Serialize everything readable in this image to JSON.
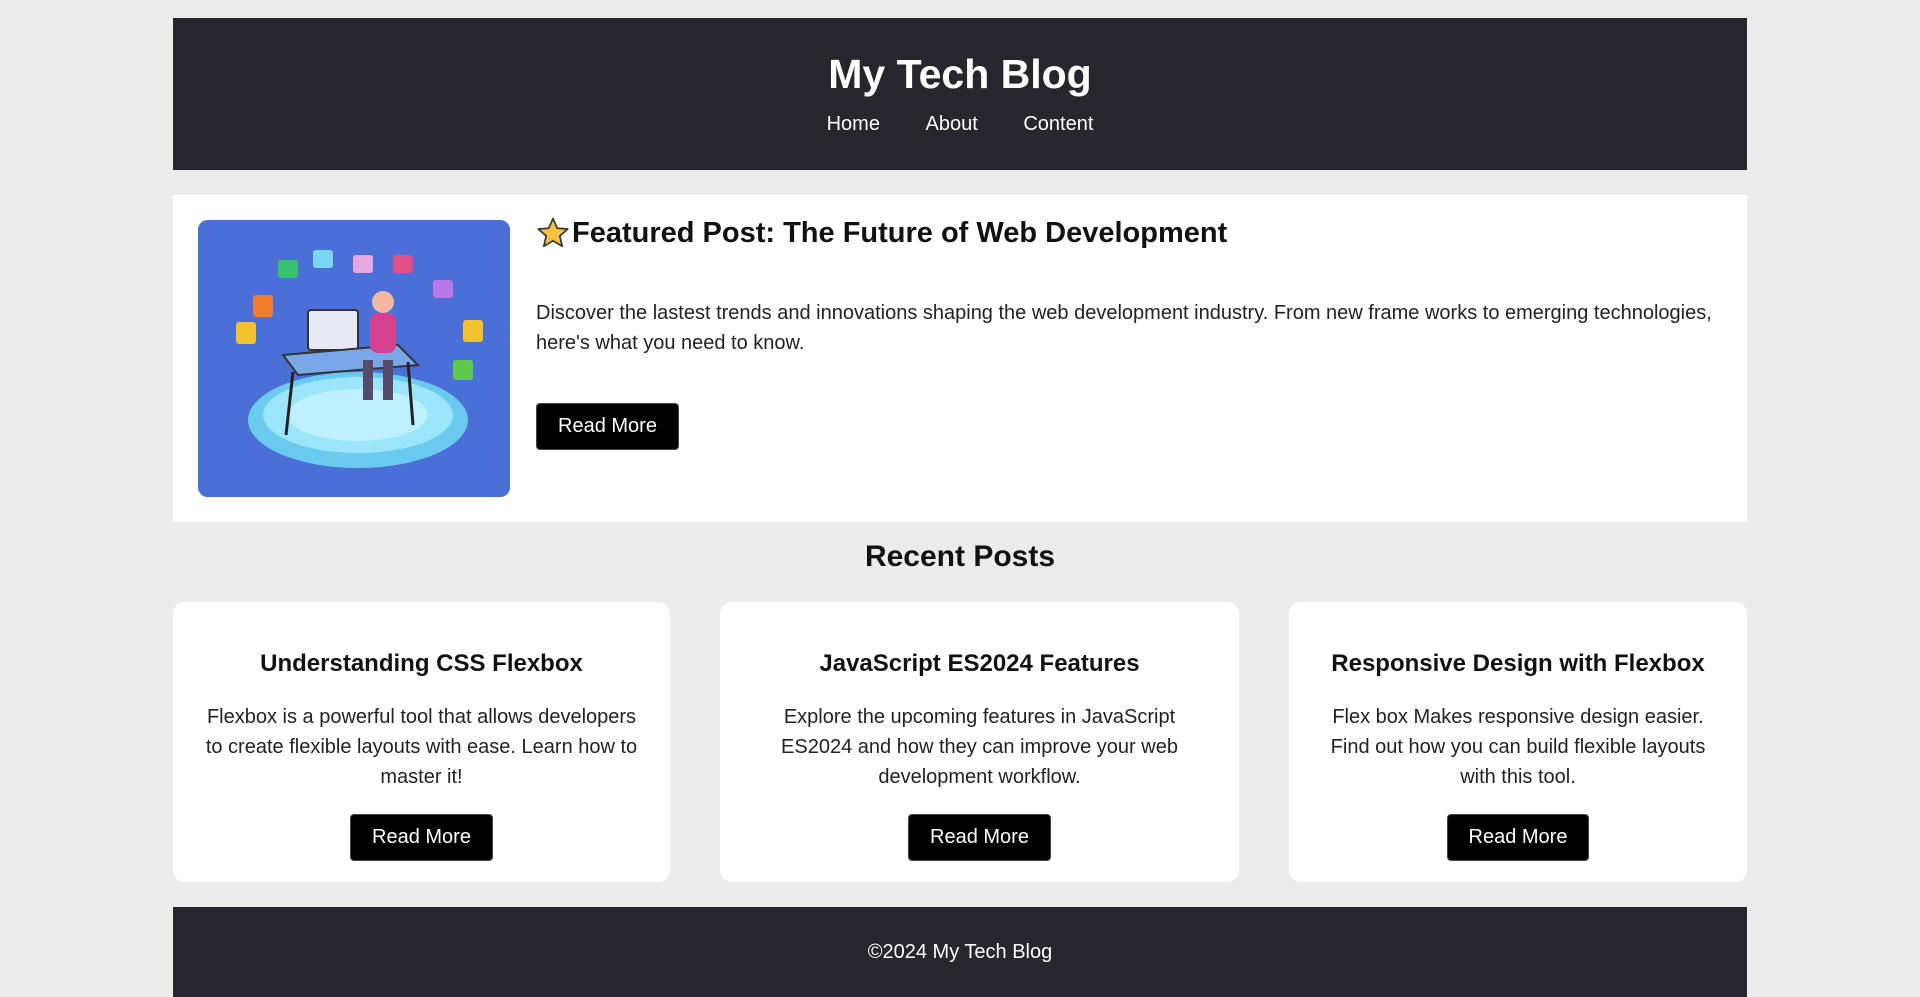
{
  "header": {
    "title": "My Tech Blog",
    "nav": [
      "Home",
      "About",
      "Content"
    ]
  },
  "featured": {
    "icon": "star-icon",
    "title": "Featured Post: The Future of Web Development",
    "text": "Discover the lastest trends and innovations shaping the web development industry. From new frame works to emerging technologies, here's what you need to know.",
    "button": "Read More",
    "image": "developer-illustration"
  },
  "recent": {
    "title": "Recent Posts",
    "posts": [
      {
        "title": "Understanding CSS Flexbox",
        "text": "Flexbox is a powerful tool that allows developers to create flexible layouts with ease. Learn how to master it!",
        "button": "Read More"
      },
      {
        "title": "JavaScript ES2024 Features",
        "text": "Explore the upcoming features in JavaScript ES2024 and how they can improve your web development workflow.",
        "button": "Read More"
      },
      {
        "title": "Responsive Design with Flexbox",
        "text": "Flex box Makes responsive design easier. Find out how you can build flexible layouts with this tool.",
        "button": "Read More"
      }
    ]
  },
  "footer": {
    "text": "©2024 My Tech Blog"
  },
  "colors": {
    "page_bg": "#ececec",
    "header_bg": "#26262c",
    "button_bg": "#000000",
    "image_bg": "#4a6fd6"
  }
}
